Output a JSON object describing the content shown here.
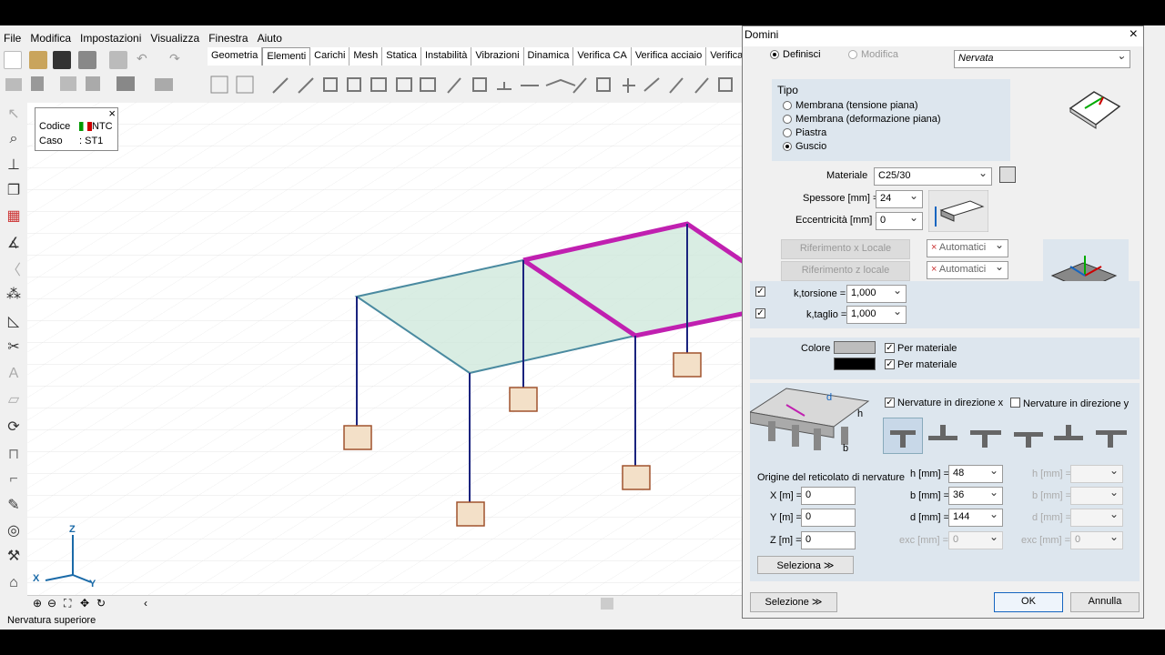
{
  "menu": [
    "File",
    "Modifica",
    "Impostazioni",
    "Visualizza",
    "Finestra",
    "Aiuto"
  ],
  "tabs": [
    "Geometria",
    "Elementi",
    "Carichi",
    "Mesh",
    "Statica",
    "Instabilità",
    "Vibrazioni",
    "Dinamica",
    "Verifica CA",
    "Verifica acciaio",
    "Verifica le"
  ],
  "info": {
    "codice_label": "Codice",
    "codice_value": "NTC",
    "caso_label": "Caso",
    "caso_value": ": ST1",
    "close": "×"
  },
  "axes": {
    "z": "Z",
    "x": "X",
    "y": "Y"
  },
  "status": "Nervatura superiore",
  "dialog": {
    "title": "Domini",
    "close": "×",
    "mode_define": "Definisci",
    "mode_modify": "Modifica",
    "type_select": "Nervata",
    "tipo_label": "Tipo",
    "tipo_options": [
      "Membrana (tensione piana)",
      "Membrana (deformazione piana)",
      "Piastra",
      "Guscio"
    ],
    "materiale_label": "Materiale",
    "materiale_value": "C25/30",
    "spessore_label": "Spessore [mm] =",
    "spessore_value": "24",
    "eccentricita_label": "Eccentricità [mm] =",
    "eccentricita_value": "0",
    "rif_x": "Riferimento x Locale",
    "rif_z": "Riferimento z locale",
    "auto1": "Automatici",
    "auto2": "Automatici",
    "ktors_label": "k,torsione =",
    "ktors_value": "1,000",
    "ktaglio_label": "k,taglio =",
    "ktaglio_value": "1,000",
    "colore_label": "Colore",
    "per_materiale1": "Per materiale",
    "per_materiale2": "Per materiale",
    "nerv_x": "Nervature in direzione x",
    "nerv_y": "Nervature in direzione y",
    "origine_label": "Origine del reticolato di nervature",
    "x_label": "X [m] =",
    "x_value": "0",
    "y_label": "Y [m] =",
    "y_value": "0",
    "z_label": "Z [m] =",
    "z_value": "0",
    "h_label": "h [mm] =",
    "h_value": "48",
    "b_label": "b [mm] =",
    "b_value": "36",
    "d_label": "d [mm] =",
    "d_value": "144",
    "exc_label": "exc [mm] =",
    "exc_value": "0",
    "h2_label": "h [mm] =",
    "b2_label": "b [mm] =",
    "d2_label": "d [mm] =",
    "exc2_label": "exc [mm] =",
    "exc2_value": "0",
    "seleziona_inner": "Seleziona  ≫",
    "seleziona": "Selezione  ≫",
    "ok": "OK",
    "annulla": "Annulla",
    "diag_h": "h",
    "diag_d": "d",
    "diag_b": "b"
  },
  "colors": {
    "accent": "#c020b0",
    "column": "#1a237e",
    "slab": "#cfe8dc"
  }
}
